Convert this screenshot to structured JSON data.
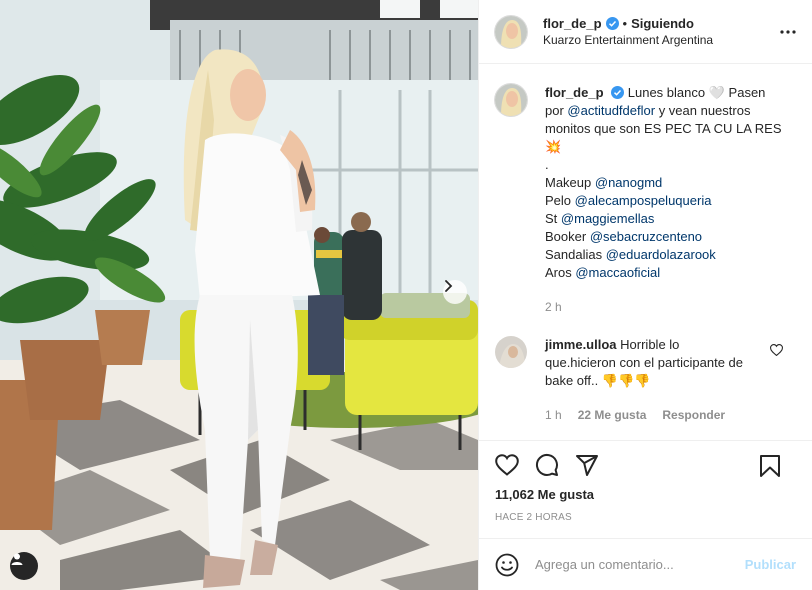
{
  "post": {
    "header": {
      "username": "flor_de_p",
      "follow_status": "Siguiendo",
      "location": "Kuarzo Entertainment Argentina"
    },
    "caption": {
      "username": "flor_de_p",
      "intro_text": "Lunes blanco",
      "white_heart": "🤍",
      "pasen": "Pasen",
      "por": "por",
      "mention_1": "@actitudfdeflor",
      "line_2_rest": "y vean nuestros",
      "line_3": "monitos que son ES PEC TA CU LA RES",
      "emoji": "💥",
      "dot": ".",
      "credits": [
        {
          "label": "Makeup",
          "mention": "@nanogmd"
        },
        {
          "label": "Pelo",
          "mention": "@alecampospeluqueria"
        },
        {
          "label": "St",
          "mention": "@maggiemellas"
        },
        {
          "label": "Booker",
          "mention": "@sebacruzcenteno"
        },
        {
          "label": "Sandalias",
          "mention": "@eduardolazarook"
        },
        {
          "label": "Aros",
          "mention": "@maccaoficial"
        }
      ],
      "time": "2 h"
    },
    "comment": {
      "username": "jimme.ulloa",
      "text_1": "Horrible lo",
      "text_2": "que.hicieron con el participante de",
      "text_3": "bake off..",
      "emoji": "👎👎👎",
      "time": "1 h",
      "likes": "22 Me gusta",
      "reply": "Responder"
    },
    "likes_count": "11,062 Me gusta",
    "posted_ago": "Hace 2 horas",
    "add_comment": {
      "placeholder": "Agrega un comentario...",
      "publish_label": "Publicar"
    }
  },
  "icons": [
    "more-options-icon",
    "verified-badge-icon",
    "heart-icon",
    "comment-icon",
    "share-icon",
    "save-icon",
    "emoji-icon",
    "next-arrow-icon",
    "user-tag-icon"
  ],
  "colors": {
    "link": "#00376b",
    "verified": "#3897f0",
    "publish_disabled": "#b2dffc",
    "muted": "#8e8e8e"
  }
}
